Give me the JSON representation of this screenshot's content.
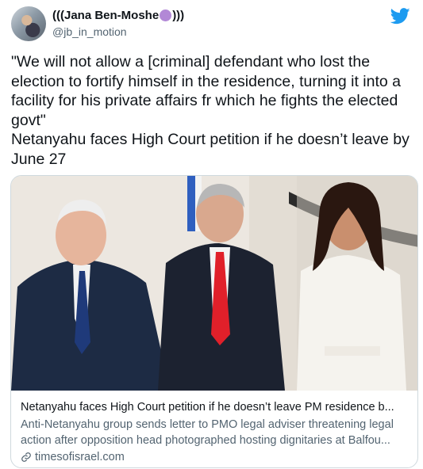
{
  "author": {
    "display_name_prefix": "(((Jana Ben-Moshe",
    "display_name_suffix": ")))",
    "handle": "@jb_in_motion"
  },
  "tweet": {
    "line1": "\"We will not allow a [criminal] defendant who lost the election to fortify himself in the residence, turning it into a facility for his private affairs fr which he fights the elected govt\"",
    "line2": "Netanyahu faces High Court petition if he doesn’t leave by June 27"
  },
  "card": {
    "title": "Netanyahu faces High Court petition if he doesn’t leave PM residence b...",
    "description": "Anti-Netanyahu group sends letter to PMO legal adviser threatening legal action after opposition head photographed hosting dignitaries at Balfou...",
    "domain": "timesofisrael.com"
  },
  "colors": {
    "twitter_blue": "#1d9bf0",
    "emoji_purple": "#b288d6",
    "secondary_text": "#536471"
  },
  "icons": [
    "twitter-bird-icon",
    "purple-circle-emoji-icon",
    "link-icon"
  ]
}
